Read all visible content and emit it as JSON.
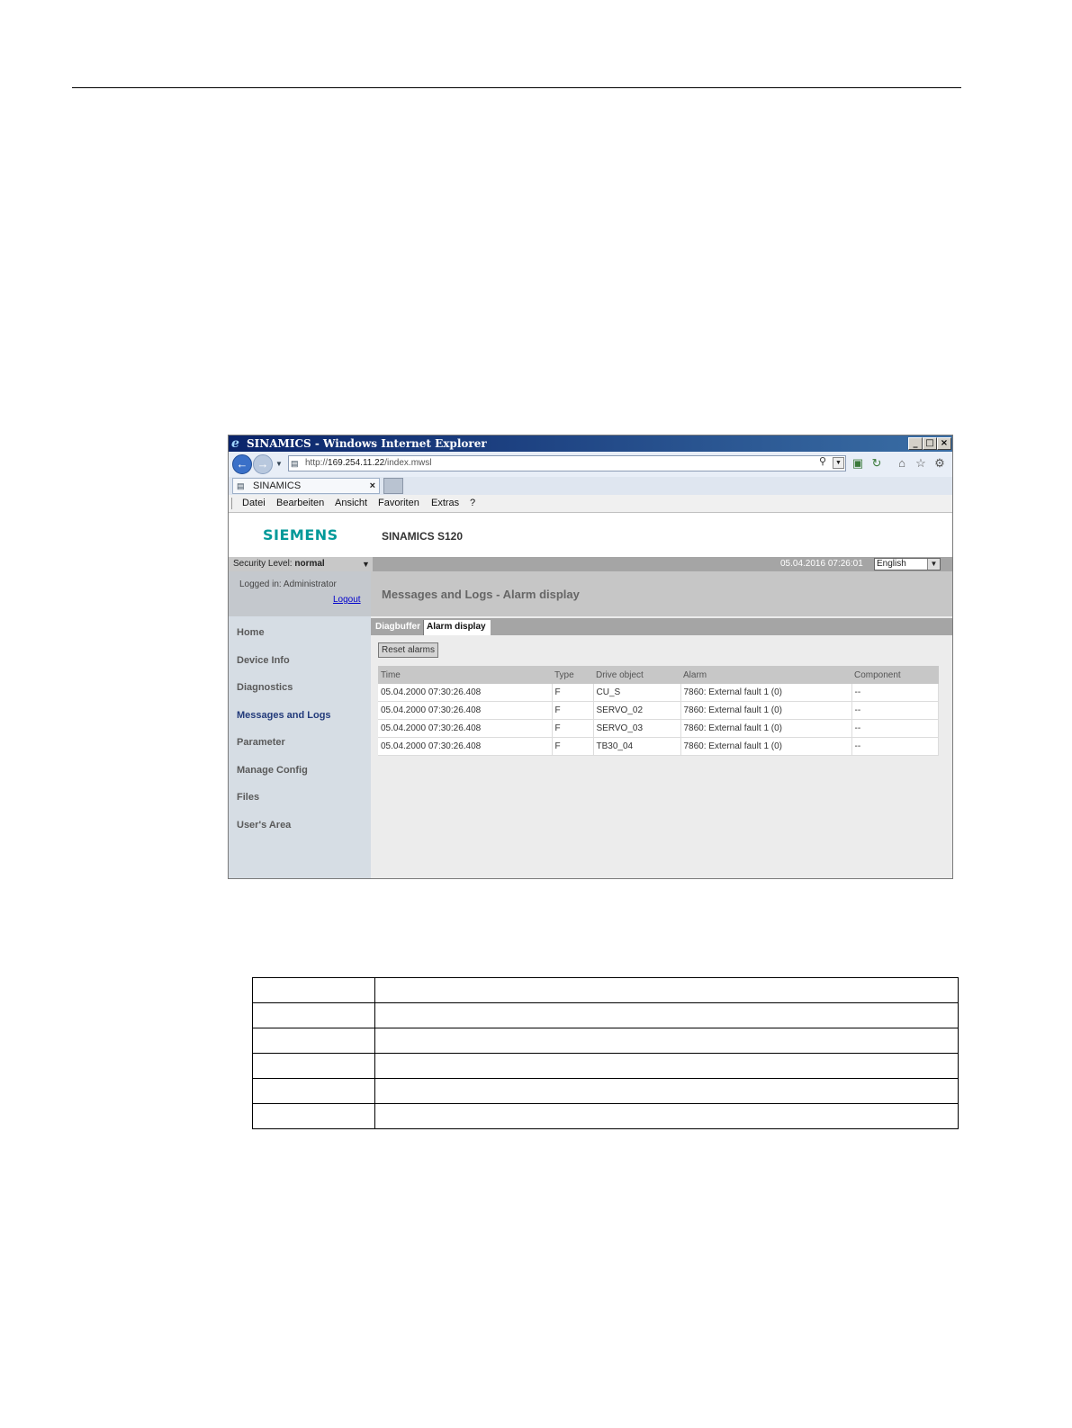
{
  "window": {
    "title": "SINAMICS - Windows Internet Explorer",
    "controls": [
      "_",
      "□",
      "×"
    ]
  },
  "browser": {
    "url_prefix": "http://",
    "url_host": "169.254.11.22",
    "url_path": "/index.mwsl",
    "tab_label": "SINAMICS",
    "tab_close": "×",
    "menu": [
      "Datei",
      "Bearbeiten",
      "Ansicht",
      "Favoriten",
      "Extras",
      "?"
    ]
  },
  "app": {
    "logo": "SIEMENS",
    "product": "SINAMICS S120",
    "security_label": "Security Level:",
    "security_value": "normal",
    "datetime": "05.04.2016 07:26:01",
    "language": "English",
    "logged_in": "Logged in: Administrator",
    "logout": "Logout",
    "nav": [
      "Home",
      "Device Info",
      "Diagnostics",
      "Messages and Logs",
      "Parameter",
      "Manage Config",
      "Files",
      "User's Area"
    ],
    "active_nav": "Messages and Logs",
    "page_title": "Messages and Logs - Alarm display",
    "tabs": [
      "Diagbuffer",
      "Alarm display"
    ],
    "active_tab": "Alarm display",
    "reset_button": "Reset alarms",
    "columns": [
      "Time",
      "Type",
      "Drive object",
      "Alarm",
      "Component"
    ],
    "rows": [
      [
        "05.04.2000 07:30:26.408",
        "F",
        "CU_S",
        "7860: External fault 1 (0)",
        "--"
      ],
      [
        "05.04.2000 07:30:26.408",
        "F",
        "SERVO_02",
        "7860: External fault 1 (0)",
        "--"
      ],
      [
        "05.04.2000 07:30:26.408",
        "F",
        "SERVO_03",
        "7860: External fault 1 (0)",
        "--"
      ],
      [
        "05.04.2000 07:30:26.408",
        "F",
        "TB30_04",
        "7860: External fault 1 (0)",
        "--"
      ]
    ]
  },
  "legend_table": {
    "rows": [
      [
        "",
        ""
      ],
      [
        "",
        ""
      ],
      [
        "",
        ""
      ],
      [
        "",
        ""
      ],
      [
        "",
        ""
      ],
      [
        "",
        ""
      ]
    ]
  }
}
